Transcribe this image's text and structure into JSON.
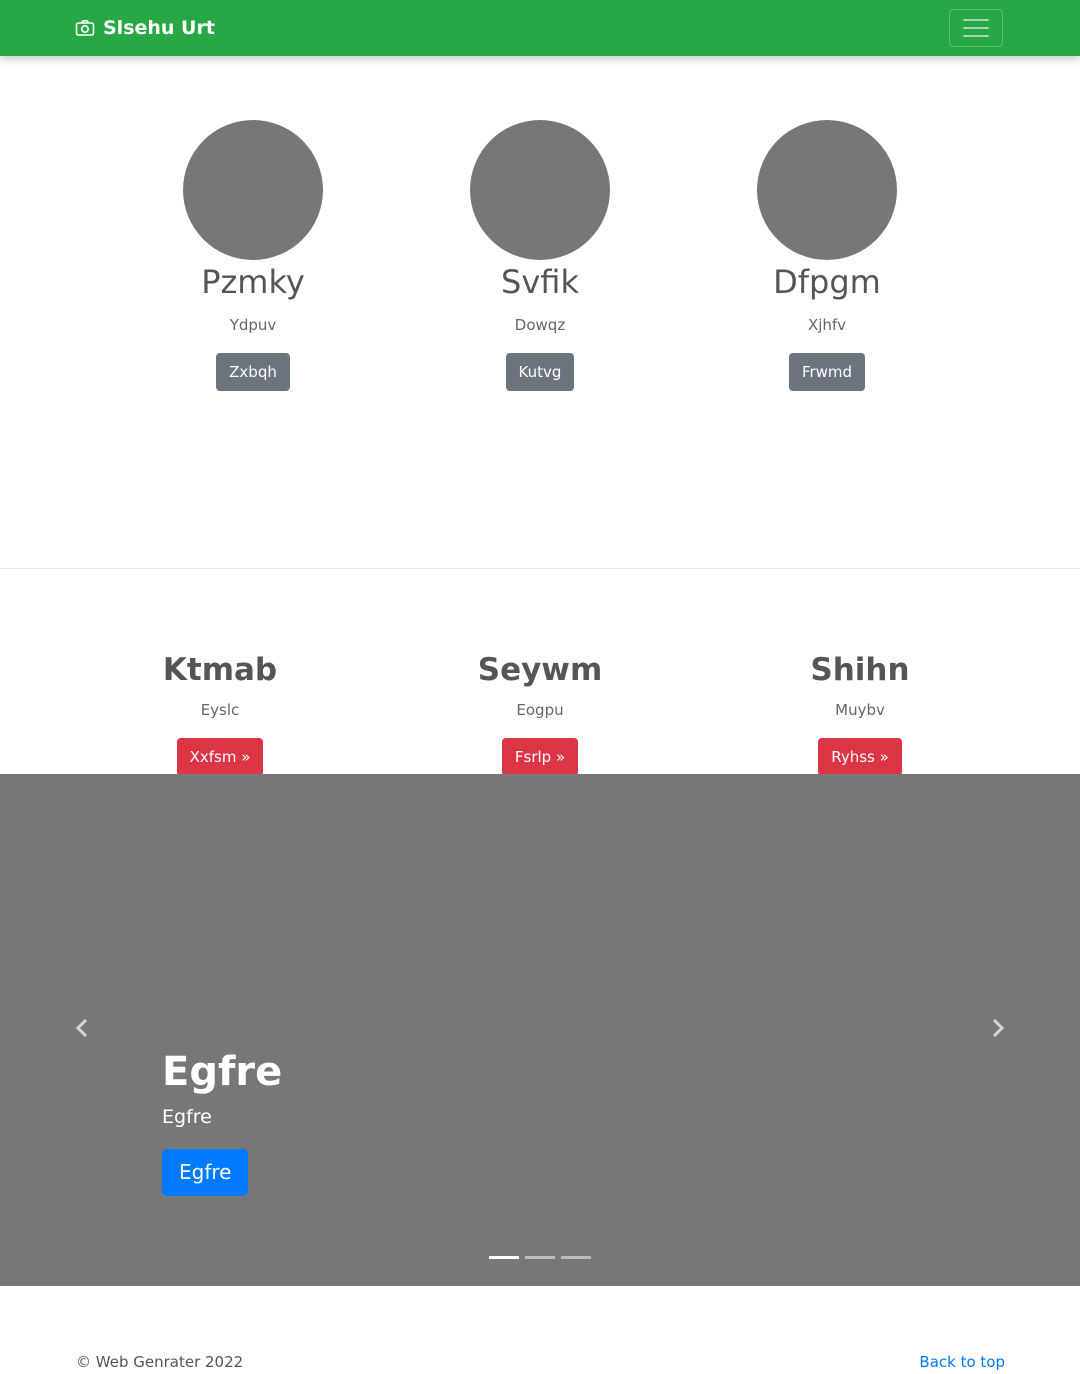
{
  "navbar": {
    "brand": "Slsehu Urt",
    "brand_icon": "camera-icon",
    "toggler_icon": "hamburger-icon",
    "background": "#28a745"
  },
  "profiles": [
    {
      "name": "Pzmky",
      "subtitle": "Ydpuv",
      "button": "Zxbqh"
    },
    {
      "name": "Svfik",
      "subtitle": "Dowqz",
      "button": "Kutvg"
    },
    {
      "name": "Dfpgm",
      "subtitle": "Xjhfv",
      "button": "Frwmd"
    }
  ],
  "features": [
    {
      "title": "Ktmab",
      "subtitle": "Eyslc",
      "button": "Xxfsm »"
    },
    {
      "title": "Seywm",
      "subtitle": "Eogpu",
      "button": "Fsrlp »"
    },
    {
      "title": "Shihn",
      "subtitle": "Muybv",
      "button": "Ryhss »"
    }
  ],
  "carousel": {
    "title": "Egfre",
    "text": "Egfre",
    "button": "Egfre",
    "prev_icon": "chevron-left-icon",
    "next_icon": "chevron-right-icon",
    "slide_count": 3,
    "active_slide": 1
  },
  "footer": {
    "copyright": "© Web Genrater 2022",
    "back_to_top": "Back to top"
  },
  "colors": {
    "accent_green": "#28a745",
    "secondary": "#6c757d",
    "danger": "#dc3545",
    "primary": "#007bff",
    "placeholder_grey": "#777777"
  }
}
